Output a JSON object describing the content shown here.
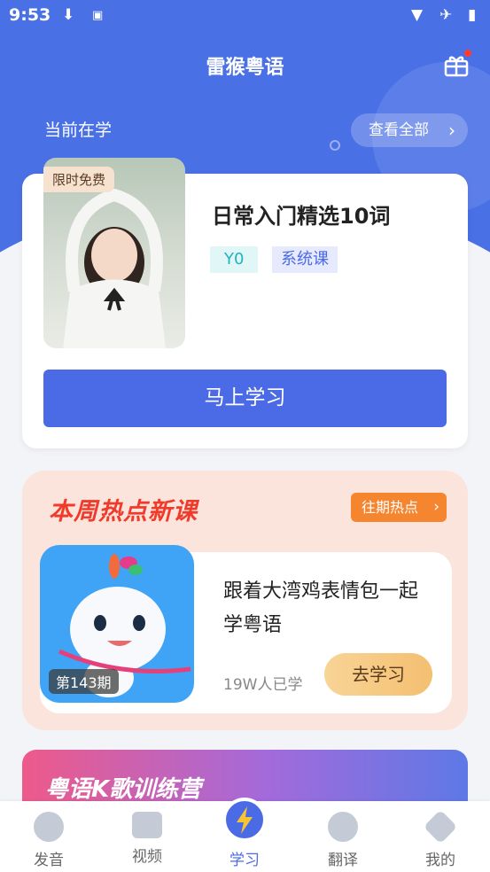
{
  "status_bar": {
    "time": "9:53",
    "icons": [
      "download-icon",
      "a-badge-icon",
      "wifi-icon",
      "airplane-icon",
      "battery-icon"
    ]
  },
  "header": {
    "title": "雷猴粤语",
    "gift_icon": "gift-icon"
  },
  "current": {
    "label": "当前在学",
    "view_all": "查看全部"
  },
  "course": {
    "free_tag": "限时免费",
    "title": "日常入门精选10词",
    "tags": [
      "Y0",
      "系统课"
    ],
    "study_button": "马上学习"
  },
  "hot": {
    "title": "本周热点新课",
    "past_button": "往期热点",
    "issue": "第143期",
    "lesson_title": "跟着大湾鸡表情包一起学粤语",
    "learners": "19W人已学",
    "go_button": "去学习"
  },
  "karaoke": {
    "title": "粤语K歌训练营"
  },
  "tabbar": {
    "items": [
      {
        "label": "发音",
        "icon": "pronunciation-icon"
      },
      {
        "label": "视频",
        "icon": "video-icon"
      },
      {
        "label": "学习",
        "icon": "lightning-icon",
        "active": true
      },
      {
        "label": "翻译",
        "icon": "translate-icon"
      },
      {
        "label": "我的",
        "icon": "profile-icon"
      }
    ]
  },
  "colors": {
    "primary": "#4a6ae6",
    "hot_accent": "#f03b2a",
    "past_button": "#f6852f"
  }
}
